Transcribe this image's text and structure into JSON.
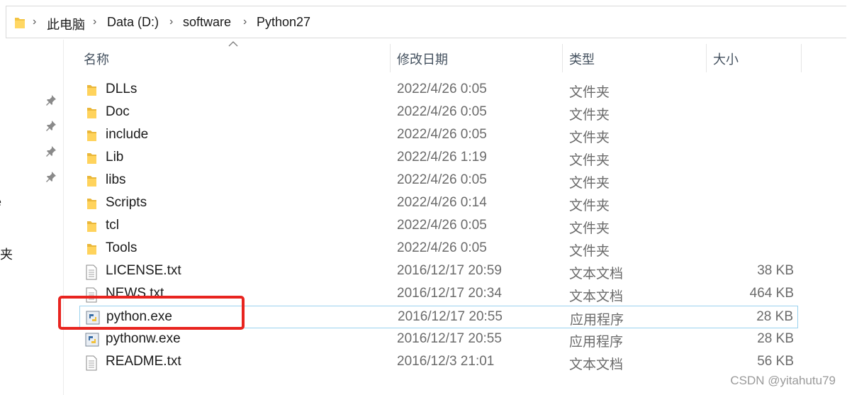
{
  "breadcrumb": {
    "items": [
      "此电脑",
      "Data (D:)",
      "software",
      "Python27"
    ]
  },
  "left_pane": {
    "partial_texts": [
      "e",
      "夹"
    ]
  },
  "columns": {
    "name": "名称",
    "date": "修改日期",
    "type": "类型",
    "size": "大小"
  },
  "files": [
    {
      "name": "DLLs",
      "date": "2022/4/26 0:05",
      "type": "文件夹",
      "size": "",
      "icon": "folder-icon"
    },
    {
      "name": "Doc",
      "date": "2022/4/26 0:05",
      "type": "文件夹",
      "size": "",
      "icon": "folder-icon"
    },
    {
      "name": "include",
      "date": "2022/4/26 0:05",
      "type": "文件夹",
      "size": "",
      "icon": "folder-icon"
    },
    {
      "name": "Lib",
      "date": "2022/4/26 1:19",
      "type": "文件夹",
      "size": "",
      "icon": "folder-icon"
    },
    {
      "name": "libs",
      "date": "2022/4/26 0:05",
      "type": "文件夹",
      "size": "",
      "icon": "folder-icon"
    },
    {
      "name": "Scripts",
      "date": "2022/4/26 0:14",
      "type": "文件夹",
      "size": "",
      "icon": "folder-icon"
    },
    {
      "name": "tcl",
      "date": "2022/4/26 0:05",
      "type": "文件夹",
      "size": "",
      "icon": "folder-icon"
    },
    {
      "name": "Tools",
      "date": "2022/4/26 0:05",
      "type": "文件夹",
      "size": "",
      "icon": "folder-icon"
    },
    {
      "name": "LICENSE.txt",
      "date": "2016/12/17 20:59",
      "type": "文本文档",
      "size": "38 KB",
      "icon": "text-file-icon"
    },
    {
      "name": "NEWS.txt",
      "date": "2016/12/17 20:34",
      "type": "文本文档",
      "size": "464 KB",
      "icon": "text-file-icon"
    },
    {
      "name": "python.exe",
      "date": "2016/12/17 20:55",
      "type": "应用程序",
      "size": "28 KB",
      "icon": "python-exe-icon"
    },
    {
      "name": "pythonw.exe",
      "date": "2016/12/17 20:55",
      "type": "应用程序",
      "size": "28 KB",
      "icon": "python-exe-icon"
    },
    {
      "name": "README.txt",
      "date": "2016/12/3 21:01",
      "type": "文本文档",
      "size": "56 KB",
      "icon": "text-file-icon"
    }
  ],
  "selected_file": "python.exe",
  "annotation_color": "#e8241f",
  "watermark": "CSDN @yitahutu79"
}
